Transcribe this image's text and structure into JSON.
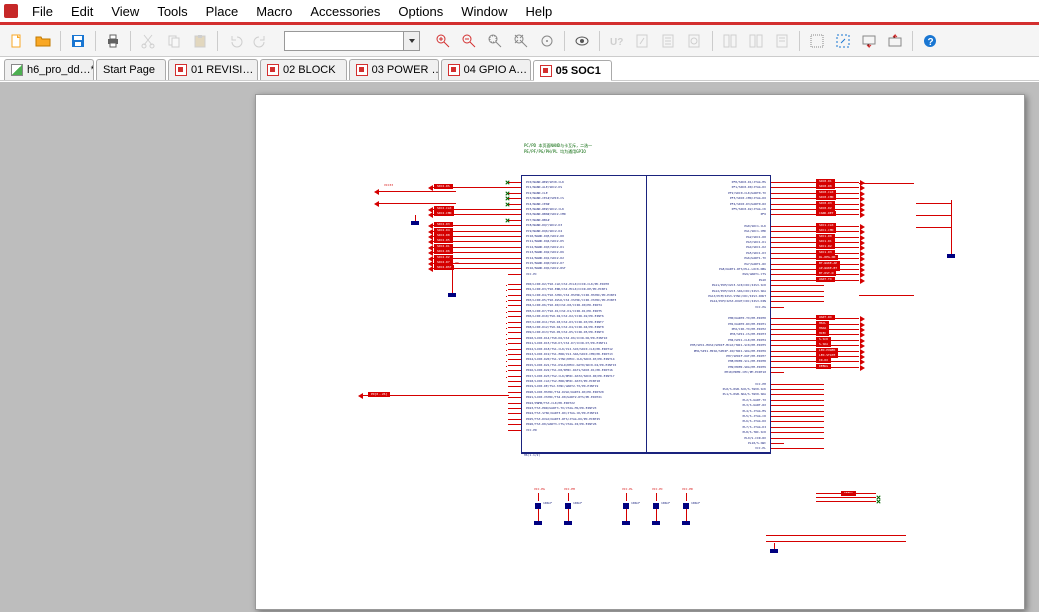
{
  "menu": [
    "File",
    "Edit",
    "View",
    "Tools",
    "Place",
    "Macro",
    "Accessories",
    "Options",
    "Window",
    "Help"
  ],
  "toolbar": {
    "combo_value": ""
  },
  "tabs": [
    {
      "label": "h6_pro_dd…*",
      "icon": "doc",
      "active": false
    },
    {
      "label": "Start Page",
      "icon": "",
      "active": false
    },
    {
      "label": "01 REVISI…",
      "icon": "page",
      "active": false
    },
    {
      "label": "02 BLOCK",
      "icon": "page",
      "active": false
    },
    {
      "label": "03 POWER …",
      "icon": "page",
      "active": false
    },
    {
      "label": "04 GPIO A…",
      "icon": "page",
      "active": false
    },
    {
      "label": "05 SOC1",
      "icon": "page",
      "active": true
    }
  ],
  "schematic": {
    "title_lines": [
      "PC/PD 本页面NAND与卡互斥，二选一",
      "PE/PF/PG/PH/PL 均为通用GPIO"
    ],
    "chip_ref": "H6(1-1/2)",
    "left_chip_pins": [
      "PC0/NAND-WE#/SPI0-CLK",
      "PC1/NAND-ALE/SDC2-DS",
      "PC2/NAND-CLE",
      "PC3/NAND-CE1#/SPI0-CS",
      "PC4/NAND-CE0#",
      "PC5/NAND-RE#/SDC2-CLK",
      "PC6/NAND-RB0#/SDC2-CMD",
      "PC7/NAND-RB1#",
      "PC8/NAND-DQ7/SDC2-D3",
      "PC9/NAND-DQ6/SDC2-D4",
      "PC10/NAND-DQ5/SDC2-D0",
      "PC11/NAND-DQ4/SDC2-D5",
      "PC12/NAND-DQ3/SDC2-D1",
      "PC13/NAND-DQ2/SDC2-D6",
      "PC14/NAND-DQ1/SDC2-D2",
      "PC15/NAND-DQ0/SDC2-D7",
      "PC16/NAND-DQS/SDC2-RST",
      "VCC-PC",
      "PD0/LCD0-D2/TS0-CLK/CSI-PCLK/CCIR-CLK/PD-EINT0",
      "PD1/LCD0-D3/TS0-ERR/CSI-MCLK/CCIR-DE/PD-EINT1",
      "PD2/LCD0-D4/TS0-SYNC/CSI-HSYNC/CCIR-HSYNC/PD-EINT2",
      "PD3/LCD0-D5/TS0-DVLD/CSI-VSYNC/CCIR-VSYNC/PD-EINT3",
      "PD4/LCD0-D6/TS0-D0/CSI-D0/CCIR-D0/PD-EINT4",
      "PD5/LCD0-D7/TS0-D1/CSI-D1/CCIR-D1/PD-EINT5",
      "PD6/LCD0-D10/TS0-D2/CSI-D2/CCIR-D2/PD-EINT6",
      "PD7/LCD0-D11/TS0-D3/CSI-D3/CCIR-D3/PD-EINT7",
      "PD8/LCD0-D12/TS0-D4/CSI-D4/CCIR-D4/PD-EINT8",
      "PD9/LCD0-D13/TS0-D5/CSI-D5/CCIR-D5/PD-EINT9",
      "PD10/LCD0-D14/TS0-D6/CSI-D6/CCIR-D6/PD-EINT10",
      "PD11/LCD0-D15/TS0-D7/CSI-D7/CCIR-D7/PD-EINT11",
      "PD12/LCD0-D18/TS1-CLK/CSI-SCK/SDC0-CLK/PD-EINT12",
      "PD13/LCD0-D19/TS1-ERR/CSI-SDA/SDC0-CMD/PD-EINT13",
      "PD14/LCD0-D20/TS1-SYNC/DMIC-CLK/SDC0-D3/PD-EINT14",
      "PD15/LCD0-D21/TS1-DVLD/DMIC-DAT0/SDC0-D2/PD-EINT15",
      "PD16/LCD0-D22/TS1-D0/DMIC-DAT1/SDC0-D1/PD-EINT16",
      "PD17/LCD0-D23/TS2-CLK/DMIC-DAT2/SDC0-D0/PD-EINT17",
      "PD18/LCD0-CLK/TS2-ERR/DMIC-DAT3/PD-EINT18",
      "PD19/LCD0-DE/TS2-SYNC/UART2-TX/PD-EINT19",
      "PD20/LCD0-HSYNC/TS2-DVLD/UART2-RX/PD-EINT20",
      "PD21/LCD0-VSYNC/TS2-D0/UART2-RTS/PD-EINT21",
      "PD22/PWM0/TS3-CLK/PD-EINT22",
      "PD23/TS3-ERR/UART3-TX/JTAG-MS/PD-EINT23",
      "PD24/TS3-SYNC/UART3-RX/JTAG-CK/PD-EINT24",
      "PD25/TS3-DVLD/UART3-RTS/JTAG-DO/PD-EINT25",
      "PD26/TS3-D0/UART3-CTS/JTAG-DI/PD-EINT26",
      "VCC-PD"
    ],
    "right_chip_pins": [
      "PF0/SDC0-D1/JTAG-MS",
      "PF1/SDC0-D0/JTAG-DI",
      "PF2/SDC0-CLK/UART0-TX",
      "PF3/SDC0-CMD/JTAG-DO",
      "PF4/SDC0-D3/UART0-RX",
      "PF5/SDC0-D2/JTAG-CK",
      "PF6",
      "PG0/SDC1-CLK",
      "PG1/SDC1-CMD",
      "PG2/SDC1-D0",
      "PG3/SDC1-D1",
      "PG4/SDC1-D2",
      "PG5/SDC1-D3",
      "PG6/UART1-TX",
      "PG7/UART1-RX",
      "PG8/UART1-RTS/PLL-LOCK-DBG",
      "PG9/UART1-CTS",
      "PG10",
      "PG11/PCM/I2C3-SCK/CDC/I2S3-SCK",
      "PG12/PCM/I2C3-SDA/CDC/I2S3-SDA",
      "PG13/PCM/I2S3-SYNC/CDC/I2S3-DOUT",
      "PG14/PCM/I2S3-DOUT/CDC/I2S3-DIN",
      "VCC-PG",
      "PH0/UART0-TX/PH-EINT0",
      "PH1/UART0-RX/PH-EINT1",
      "PH2/CIR-TX/PH-EINT2",
      "PH3/SPI1-CS/PH-EINT3",
      "PH4/SPI1-CLK/PH-EINT4",
      "PH5/SPI1-MOSI/SPDIF-MCLK/TWI1-SCK/PH-EINT5",
      "PH6/SPI1-MISO/SPDIF-IN/TWI1-SDA/PH-EINT6",
      "PH7/SPDIF-OUT/PH-EINT7",
      "PH8/HDMI-SCL/PH-EINT8",
      "PH9/HDMI-SDA/PH-EINT9",
      "PH10/HDMI-CEC/PH-EINT10",
      "VCC-PH",
      "PL0/S-RSB-SCK/S-TWI0-SCK",
      "PL1/S-RSB-SDA/S-TWI0-SDA",
      "PL2/S-UART-TX",
      "PL3/S-UART-RX",
      "PL4/S-JTAG-MS",
      "PL5/S-JTAG-CK",
      "PL6/S-JTAG-DO",
      "PL7/S-JTAG-DI",
      "PL8/S-TWI-SCK",
      "PL9/S-CIR-RX",
      "PL10/S-OWC",
      "VCC-PL"
    ],
    "left_nets": [
      "SDC2-DS",
      "SDC2-CLK",
      "SDC2-CMD",
      "SDC2-D3",
      "SDC2-D4",
      "SDC2-D0",
      "SDC2-D5",
      "SDC2-D1",
      "SDC2-D6",
      "SDC2-D2",
      "SDC2-D7",
      "SDC2-RST",
      "PD[0..26]",
      "VCC-PD"
    ],
    "right_nets": [
      "SDC0-D1",
      "SDC0-D0",
      "SDC0-CLK",
      "SDC0-CMD",
      "SDC0-D3",
      "SDC0-D2",
      "CARD-DET",
      "SDC1-CLK",
      "SDC1-CMD",
      "SDC1-D0",
      "SDC1-D1",
      "SDC1-D2",
      "SDC1-D3",
      "WL-REG-ON",
      "BT-WAKE-AP",
      "AP-WAKE-BT",
      "BT-RST-N",
      "UART-TX",
      "UART-RX",
      "HSCL",
      "HSDA",
      "HCEC",
      "S-SCK",
      "S-SDA",
      "LED-POWER",
      "LED-STATE",
      "IR-RX",
      "DEBUG"
    ],
    "pwr_labels": [
      "VCC-PG",
      "VCC-PH",
      "VCC-PL",
      "VCC-PC",
      "VCC-PD",
      "VCC33"
    ],
    "cap_values": [
      "100nF",
      "100nF",
      "100nF",
      "100nF",
      "100nF"
    ],
    "res_values": [
      "10K",
      "10K",
      "0R"
    ]
  }
}
